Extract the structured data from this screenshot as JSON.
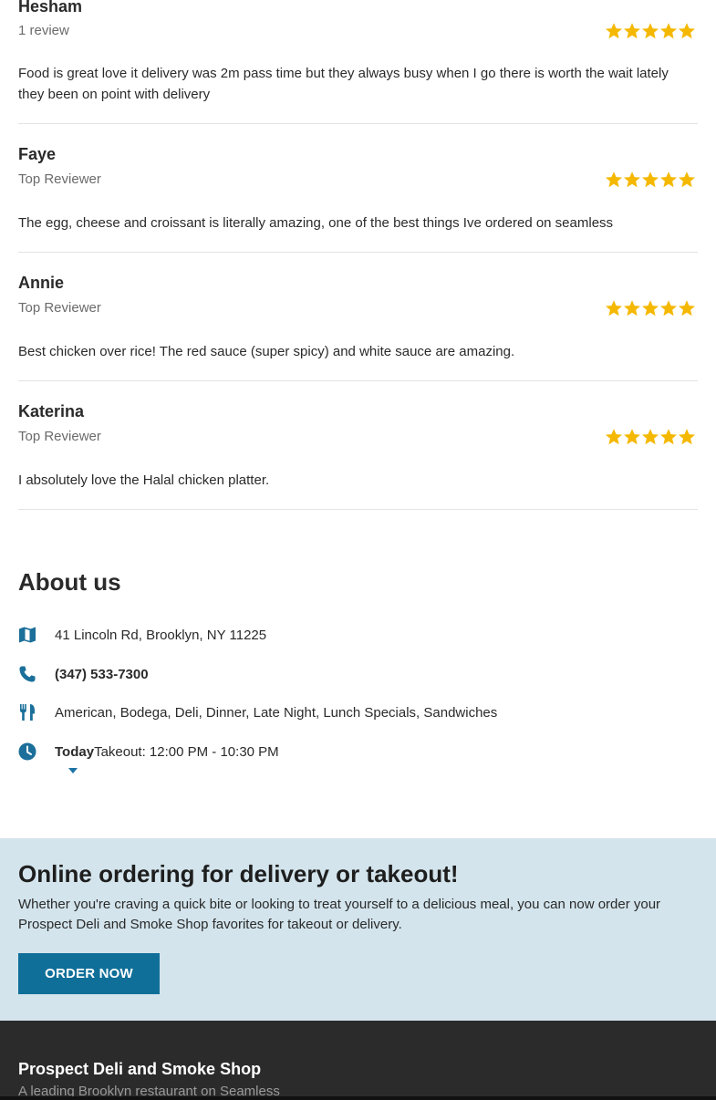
{
  "reviews": [
    {
      "name": "Hesham",
      "meta": "1 review",
      "rating": 5,
      "text": "Food is great love it delivery was 2m pass time but they always busy when I go there is worth the wait lately they been on point with delivery"
    },
    {
      "name": "Faye",
      "meta": "Top Reviewer",
      "rating": 5,
      "text": "The egg, cheese and croissant is literally amazing, one of the best things Ive ordered on seamless"
    },
    {
      "name": "Annie",
      "meta": "Top Reviewer",
      "rating": 5,
      "text": "Best chicken over rice! The red sauce (super spicy) and white sauce are amazing."
    },
    {
      "name": "Katerina",
      "meta": "Top Reviewer",
      "rating": 5,
      "text": "I absolutely love the Halal chicken platter."
    }
  ],
  "star_color": "#f5b800",
  "about": {
    "title": "About us",
    "address": "41 Lincoln Rd, Brooklyn, NY 11225",
    "phone": "(347) 533-7300",
    "cuisines": "American, Bodega, Deli, Dinner, Late Night, Lunch Specials, Sandwiches",
    "hours_day": "Today",
    "hours_text": "Takeout: 12:00 PM - 10:30 PM",
    "icons": [
      "map-icon",
      "phone-icon",
      "utensils-icon",
      "clock-icon"
    ],
    "icon_color": "#1b6f9a"
  },
  "promo": {
    "title": "Online ordering for delivery or takeout!",
    "body": "Whether you're craving a quick bite or looking to treat yourself to a delicious meal, you can now order your Prospect Deli and Smoke Shop favorites for takeout or delivery.",
    "button": "ORDER NOW",
    "background": "#d3e4ec",
    "button_color": "#0f6f99"
  },
  "footer": {
    "name": "Prospect Deli and Smoke Shop",
    "tagline": "A leading Brooklyn restaurant on Seamless"
  }
}
